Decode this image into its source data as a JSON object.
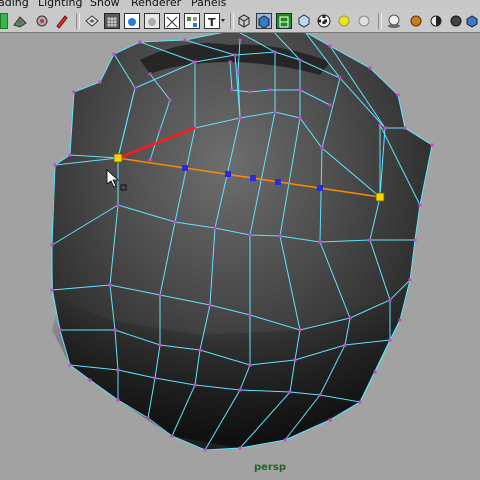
{
  "menubar": {
    "items": [
      "ading",
      "Lighting",
      "Show",
      "Renderer",
      "Panels"
    ]
  },
  "toolbar": {
    "icons": [
      "bars-icon",
      "paint-icon",
      "gear-icon",
      "brush-icon",
      "select-camera-icon",
      "grid-icon",
      "film-gate-icon",
      "resolution-gate-icon",
      "field-chart-icon",
      "safe-action-icon",
      "text-icon",
      "wireframe-cube-icon",
      "smooth-shade-cube-icon",
      "wireframe-on-shaded-icon",
      "textured-cube-icon",
      "checker-icon",
      "light-sphere-icon",
      "sphere-icon",
      "shadow-sphere-icon",
      "sun-icon",
      "half-sphere-icon",
      "xray-icon",
      "isolate-icon"
    ]
  },
  "viewport": {
    "camera_label": "persp",
    "background_color": "#a2a2a2",
    "wire_color": "#5fe3ff",
    "vertex_color": "#cc44cc",
    "selected_vertex_color": "#f5d400",
    "edge_loop_color": "#ff8a00",
    "highlight_edge_color": "#ff1a1a",
    "edge_point_color": "#2a2adf"
  }
}
